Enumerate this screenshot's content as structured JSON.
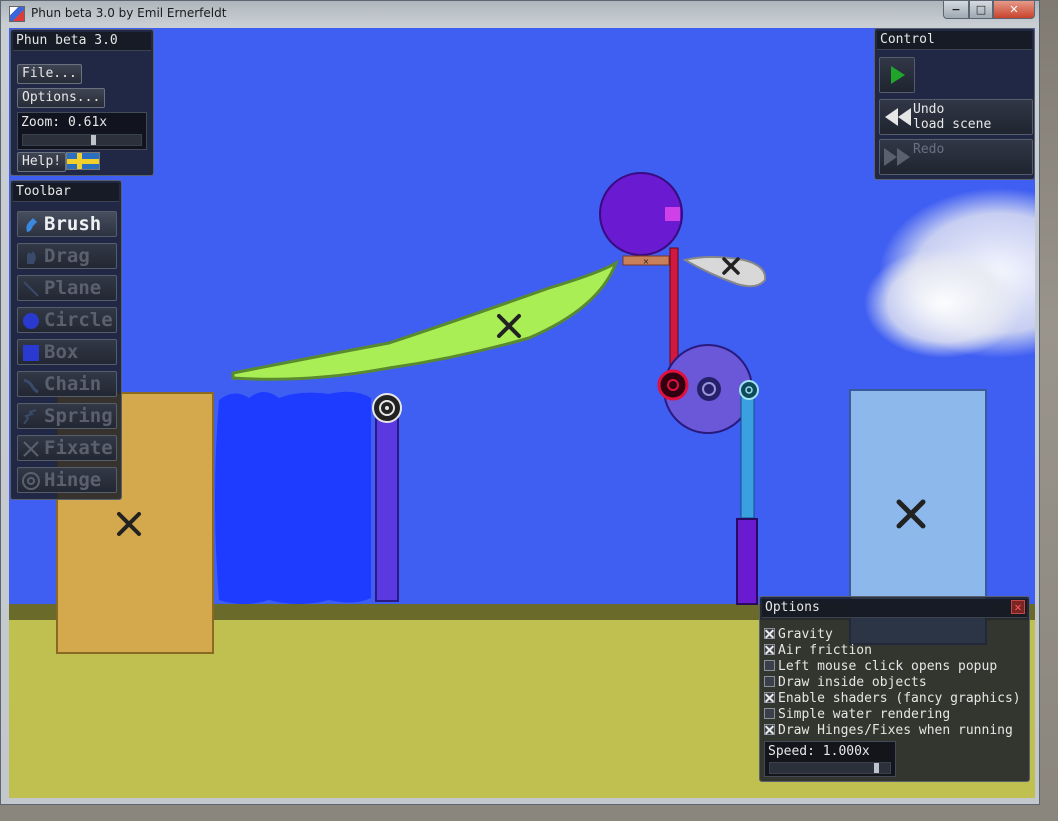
{
  "window": {
    "title": "Phun beta 3.0 by Emil Ernerfeldt",
    "min_label": "−",
    "max_label": "□",
    "close_label": "✕"
  },
  "main_panel": {
    "title": "Phun beta 3.0",
    "file_label": "File...",
    "options_label": "Options...",
    "zoom_label": "Zoom: 0.61x",
    "zoom_value": 0.61,
    "zoom_slider_fraction": 0.6,
    "help_label": "Help!",
    "flag_icon": "swedish-flag-icon"
  },
  "toolbar": {
    "title": "Toolbar",
    "active_tool": "brush",
    "tools": [
      {
        "id": "brush",
        "label": "Brush",
        "icon": "brush-icon"
      },
      {
        "id": "drag",
        "label": "Drag",
        "icon": "hand-icon"
      },
      {
        "id": "plane",
        "label": "Plane",
        "icon": "plane-icon"
      },
      {
        "id": "circle",
        "label": "Circle",
        "icon": "circle-icon"
      },
      {
        "id": "box",
        "label": "Box",
        "icon": "box-icon"
      },
      {
        "id": "chain",
        "label": "Chain",
        "icon": "chain-icon"
      },
      {
        "id": "spring",
        "label": "Spring",
        "icon": "spring-icon"
      },
      {
        "id": "fixate",
        "label": "Fixate",
        "icon": "fixate-icon"
      },
      {
        "id": "hinge",
        "label": "Hinge",
        "icon": "hinge-icon"
      }
    ]
  },
  "control": {
    "title": "Control",
    "play_icon": "play-icon",
    "undo_line1": "Undo",
    "undo_line2": "load scene",
    "redo_label": "Redo"
  },
  "options": {
    "title": "Options",
    "items": [
      {
        "label": "Gravity",
        "checked": true
      },
      {
        "label": "Air friction",
        "checked": true
      },
      {
        "label": "Left mouse click opens popup",
        "checked": false
      },
      {
        "label": "Draw inside objects",
        "checked": false
      },
      {
        "label": "Enable shaders (fancy graphics)",
        "checked": true
      },
      {
        "label": "Simple water rendering",
        "checked": false
      },
      {
        "label": "Draw Hinges/Fixes when running",
        "checked": true
      }
    ],
    "speed_label": "Speed: 1.000x",
    "speed_value": 1.0,
    "speed_slider_fraction": 0.9
  },
  "colors": {
    "sky": "#3f5ef2",
    "ground": "#c0c050",
    "ground_edge": "#6a6a2a",
    "water": "#1e3cff",
    "orange_box": "#d4a84c",
    "light_blue_box": "#8cb8ec",
    "green_shape": "#aaee55",
    "purple": "#6a1ad0",
    "accent_green": "#1fa52a"
  }
}
